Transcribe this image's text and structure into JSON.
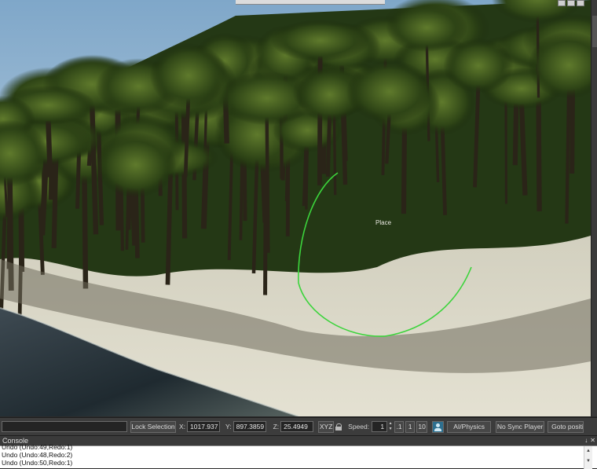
{
  "viewport": {
    "place_label": "Place"
  },
  "toolbar": {
    "lock_selection_label": "Lock Selection",
    "x_label": "X:",
    "x_value": "1017.937",
    "y_label": "Y:",
    "y_value": "897.3859",
    "z_label": "Z:",
    "z_value": "25.4949",
    "xyz_label": "XYZ",
    "speed_label": "Speed:",
    "speed_value": "1",
    "speed_01": ".1",
    "speed_1": "1",
    "speed_10": "10",
    "ai_physics_label": "AI/Physics",
    "no_sync_label": "No Sync Player",
    "goto_label": "Goto positi"
  },
  "console": {
    "title": "Console",
    "pin_label": "↓",
    "close_label": "✕",
    "lines": [
      "Undo (Undo:49,Redo:1)",
      "Undo (Undo:48,Redo:2)",
      "Undo (Undo:50,Redo:1)"
    ]
  }
}
